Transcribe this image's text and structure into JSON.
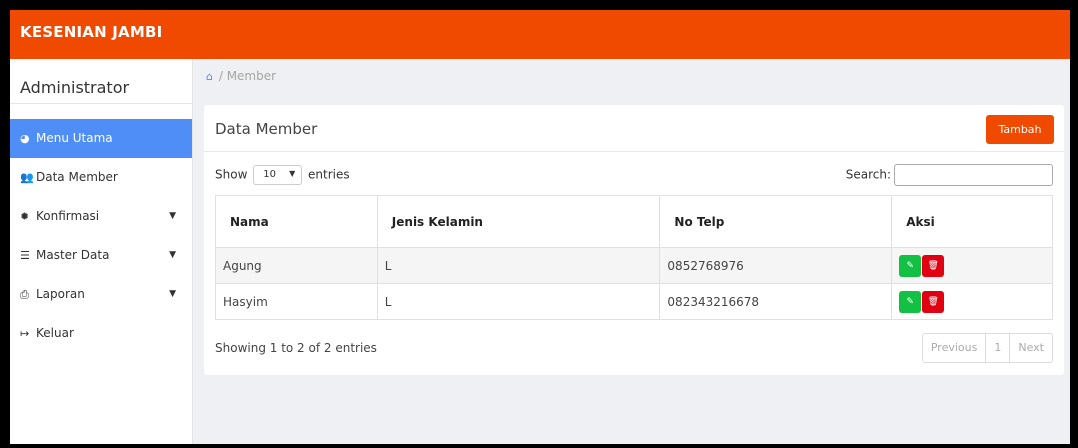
{
  "app": {
    "brand": "KESENIAN JAMBI"
  },
  "sidebar": {
    "title": "Administrator",
    "items": [
      {
        "label": "Menu Utama",
        "icon": "dashboard-icon",
        "active": true,
        "caret": false
      },
      {
        "label": "Data Member",
        "icon": "users-icon",
        "active": false,
        "caret": false
      },
      {
        "label": "Konfirmasi",
        "icon": "gear-icon",
        "active": false,
        "caret": true
      },
      {
        "label": "Master Data",
        "icon": "database-icon",
        "active": false,
        "caret": true
      },
      {
        "label": "Laporan",
        "icon": "printer-icon",
        "active": false,
        "caret": true
      },
      {
        "label": "Keluar",
        "icon": "logout-icon",
        "active": false,
        "caret": false
      }
    ]
  },
  "breadcrumb": {
    "current": "Member"
  },
  "card": {
    "title": "Data Member",
    "add_label": "Tambah",
    "show_label": "Show",
    "entries_label": "entries",
    "page_length": "10",
    "search_label": "Search:",
    "search_value": "",
    "columns": [
      "Nama",
      "Jenis Kelamin",
      "No Telp",
      "Aksi"
    ],
    "rows": [
      {
        "nama": "Agung",
        "jenis_kelamin": "L",
        "no_telp": "0852768976"
      },
      {
        "nama": "Hasyim",
        "jenis_kelamin": "L",
        "no_telp": "082343216678"
      }
    ],
    "info": "Showing 1 to 2 of 2 entries",
    "pagination": {
      "previous": "Previous",
      "page": "1",
      "next": "Next"
    }
  },
  "colors": {
    "brand": "#ef4a00",
    "active": "#4f8ef7",
    "edit": "#12c143",
    "delete": "#e00012"
  }
}
